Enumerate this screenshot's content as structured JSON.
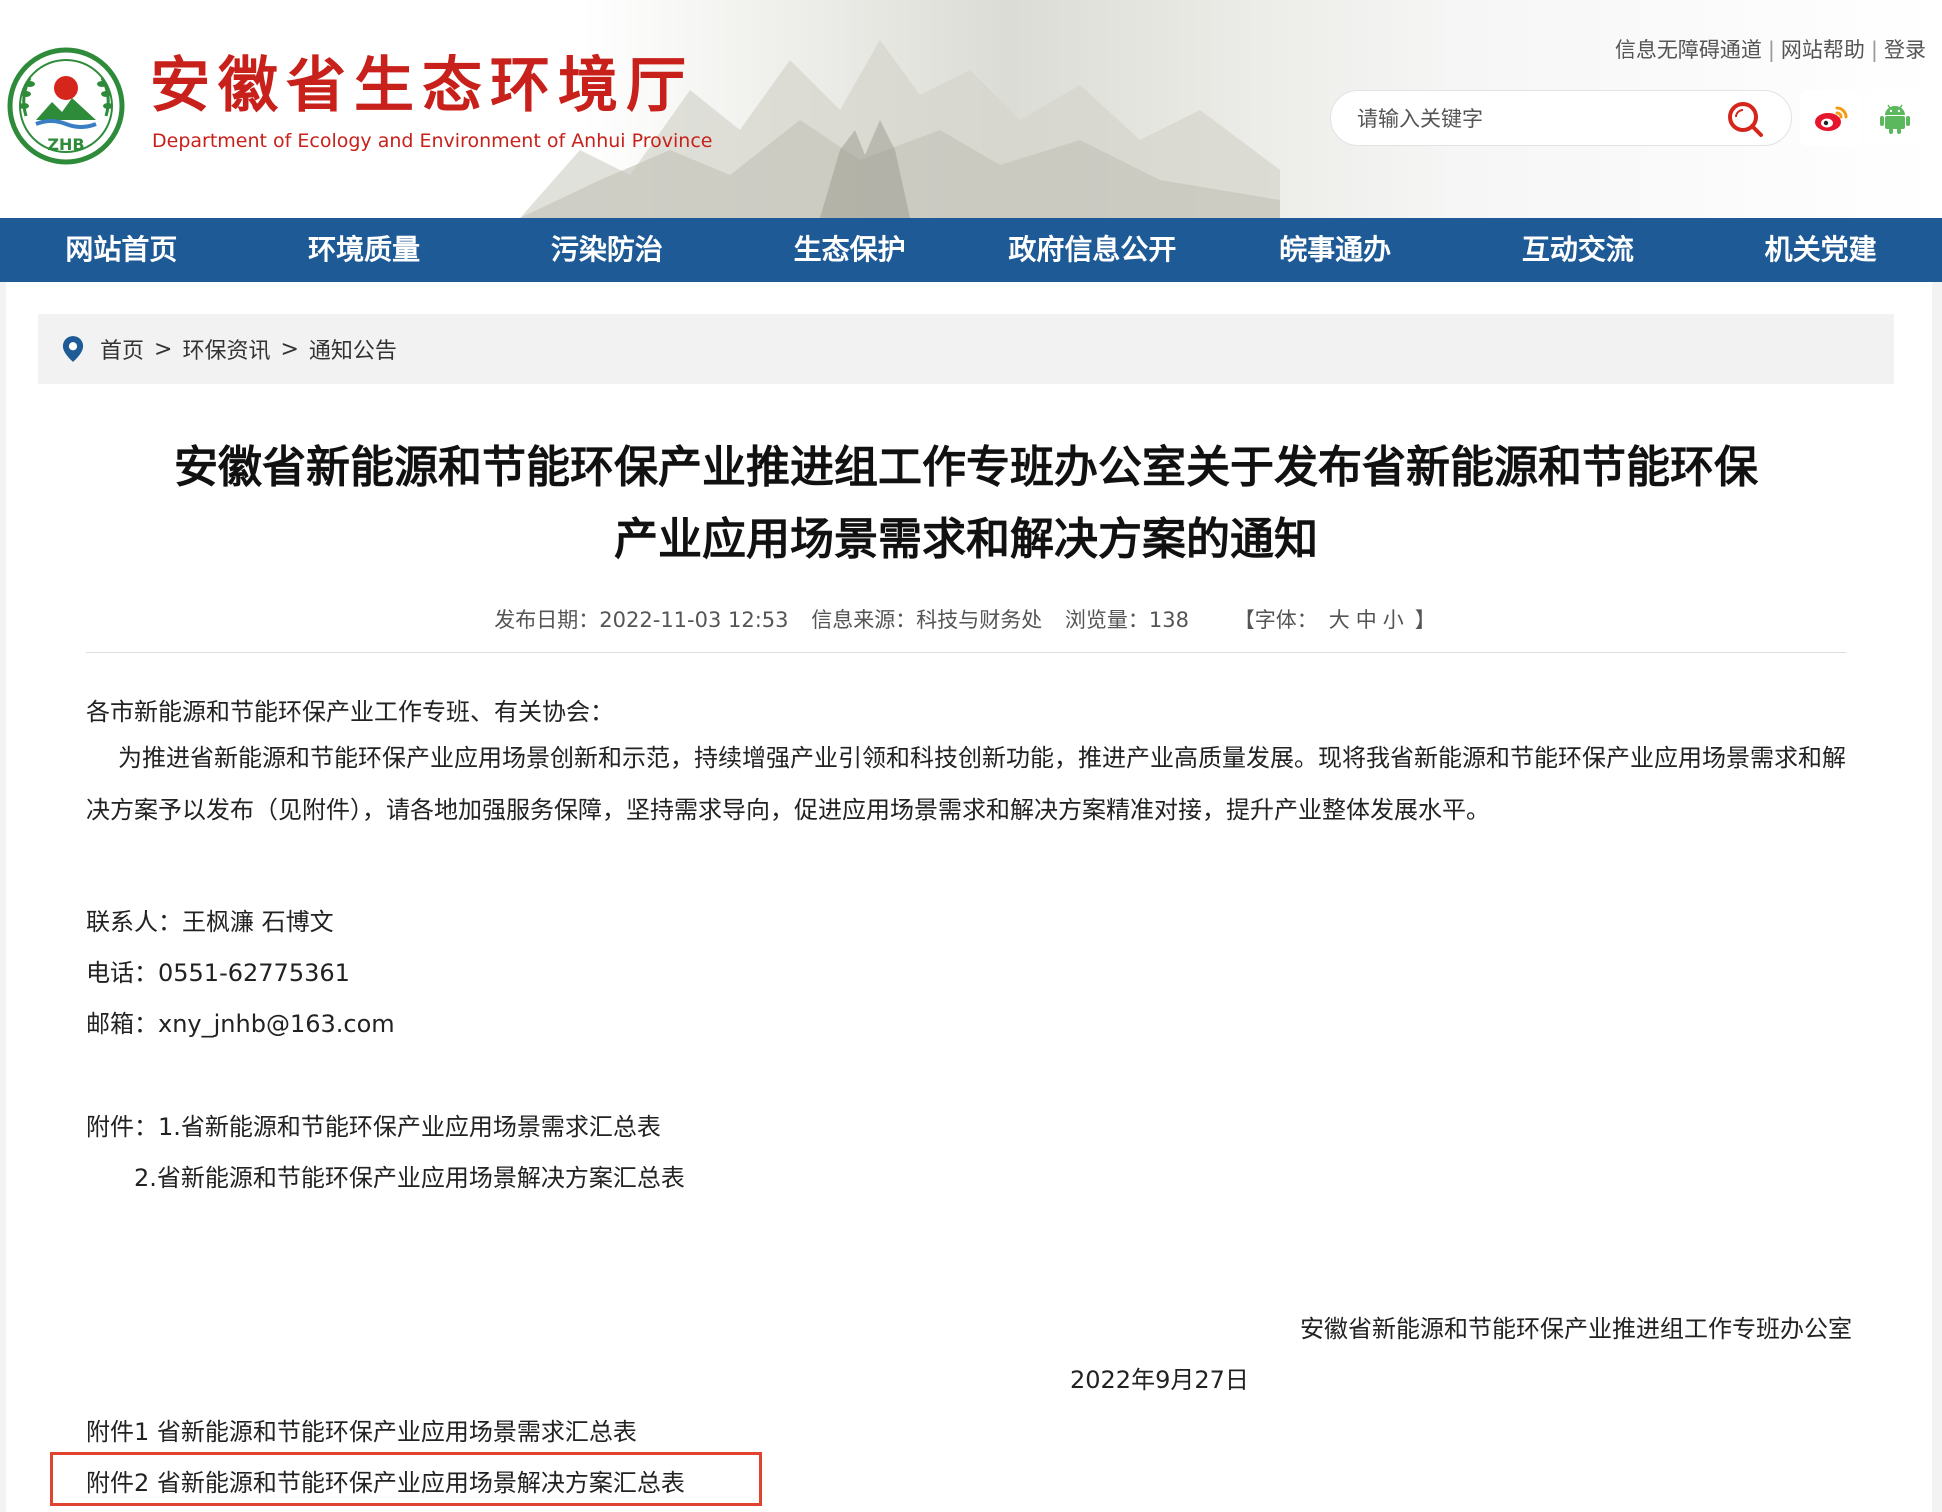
{
  "header": {
    "site_title": "安徽省生态环境厅",
    "site_subtitle": "Department of Ecology and Environment of Anhui Province",
    "logo_text": "ZHB",
    "top_links": [
      "信息无障碍通道",
      "网站帮助",
      "登录"
    ],
    "search_placeholder": "请输入关键字",
    "brand_color": "#c8201a"
  },
  "nav": {
    "color": "#1d5a96",
    "items": [
      "网站首页",
      "环境质量",
      "污染防治",
      "生态保护",
      "政府信息公开",
      "皖事通办",
      "互动交流",
      "机关党建"
    ]
  },
  "breadcrumb": {
    "items": [
      "首页",
      "环保资讯",
      "通知公告"
    ],
    "separator": ">"
  },
  "article": {
    "title_line1": "安徽省新能源和节能环保产业推进组工作专班办公室关于发布省新能源和节能环保",
    "title_line2": "产业应用场景需求和解决方案的通知",
    "meta": {
      "date": "发布日期：2022-11-03 12:53",
      "source": "信息来源：科技与财务处",
      "views": "浏览量：138",
      "font_label": "【字体：",
      "font_sizes": [
        "大",
        "中",
        "小"
      ],
      "font_close": "】"
    },
    "salutation": "各市新能源和节能环保产业工作专班、有关协会：",
    "paragraph": "为推进省新能源和节能环保产业应用场景创新和示范，持续增强产业引领和科技创新功能，推进产业高质量发展。现将我省新能源和节能环保产业应用场景需求和解决方案予以发布（见附件），请各地加强服务保障，坚持需求导向，促进应用场景需求和解决方案精准对接，提升产业整体发展水平。",
    "contact": "联系人：王枫濂   石博文",
    "phone": "电话：0551-62775361",
    "email": "邮箱：xny_jnhb@163.com",
    "attachments_label": "附件：1.省新能源和节能环保产业应用场景需求汇总表",
    "attachments_line2": "2.省新能源和节能环保产业应用场景解决方案汇总表",
    "signature": "安徽省新能源和节能环保产业推进组工作专班办公室",
    "sign_date": "2022年9月27日",
    "attachment_link1": "附件1 省新能源和节能环保产业应用场景需求汇总表",
    "attachment_link2": "附件2 省新能源和节能环保产业应用场景解决方案汇总表",
    "highlight_color": "#e0432f"
  }
}
